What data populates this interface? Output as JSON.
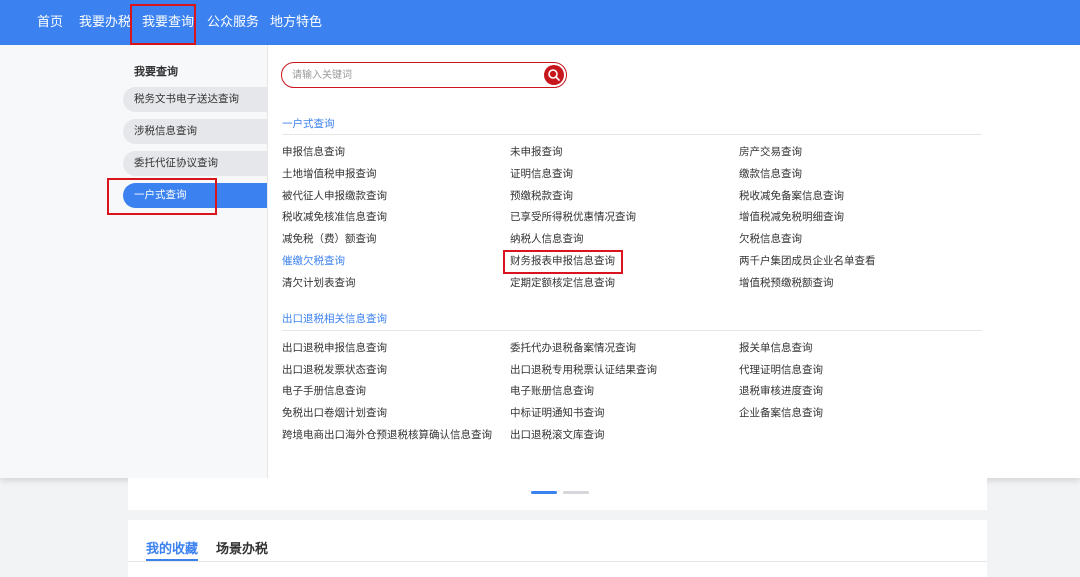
{
  "nav": {
    "items": [
      {
        "label": "首页"
      },
      {
        "label": "我要办税"
      },
      {
        "label": "我要查询"
      },
      {
        "label": "公众服务"
      },
      {
        "label": "地方特色"
      }
    ]
  },
  "sidebar": {
    "title": "我要查询",
    "items": [
      {
        "label": "税务文书电子送达查询"
      },
      {
        "label": "涉税信息查询"
      },
      {
        "label": "委托代征协议查询"
      },
      {
        "label": "一户式查询"
      }
    ]
  },
  "search": {
    "placeholder": "请输入关键词",
    "icon": "search-icon"
  },
  "sections": [
    {
      "title": "一户式查询",
      "rows": [
        [
          "申报信息查询",
          "未申报查询",
          "房产交易查询"
        ],
        [
          "土地增值税申报查询",
          "证明信息查询",
          "缴款信息查询"
        ],
        [
          "被代征人申报缴款查询",
          "预缴税款查询",
          "税收减免备案信息查询"
        ],
        [
          "税收减免核准信息查询",
          "已享受所得税优惠情况查询",
          "增值税减免税明细查询"
        ],
        [
          "减免税（费）额查询",
          "纳税人信息查询",
          "欠税信息查询"
        ],
        [
          "催缴欠税查询",
          "财务报表申报信息查询",
          "两千户集团成员企业名单查看"
        ],
        [
          "清欠计划表查询",
          "定期定额核定信息查询",
          "增值税预缴税额查询"
        ]
      ]
    },
    {
      "title": "出口退税相关信息查询",
      "rows": [
        [
          "出口退税申报信息查询",
          "委托代办退税备案情况查询",
          "报关单信息查询"
        ],
        [
          "出口退税发票状态查询",
          "出口退税专用税票认证结果查询",
          "代理证明信息查询"
        ],
        [
          "电子手册信息查询",
          "电子账册信息查询",
          "退税审核进度查询"
        ],
        [
          "免税出口卷烟计划查询",
          "中标证明通知书查询",
          "企业备案信息查询"
        ],
        [
          "跨境电商出口海外仓预退税核算确认信息查询",
          "出口退税滚文库查询",
          ""
        ]
      ]
    }
  ],
  "tabs": [
    {
      "label": "我的收藏"
    },
    {
      "label": "场景办税"
    }
  ],
  "colors": {
    "primary": "#3b82f0",
    "highlight": "#d9141c",
    "search_accent": "#c8161d"
  }
}
